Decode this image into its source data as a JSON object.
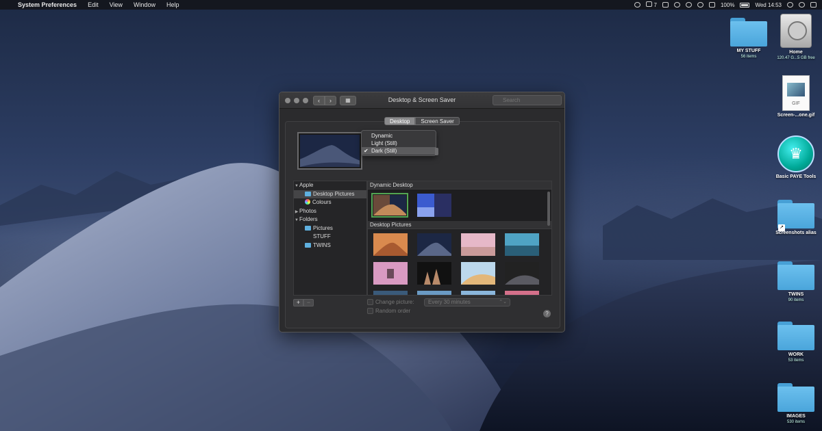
{
  "menubar": {
    "app_name": "System Preferences",
    "menus": [
      "Edit",
      "View",
      "Window",
      "Help"
    ],
    "status": {
      "notif_count": "7",
      "battery": "100%",
      "clock": "Wed 14:53"
    }
  },
  "window": {
    "title": "Desktop & Screen Saver",
    "search_placeholder": "Search",
    "tabs": [
      "Desktop",
      "Screen Saver"
    ],
    "active_tab": "Desktop",
    "appearance_menu": {
      "options": [
        "Dynamic",
        "Light (Still)",
        "Dark (Still)"
      ],
      "selected": "Dark (Still)",
      "check": "✔"
    },
    "sidebar": [
      {
        "label": "Apple",
        "type": "group",
        "expanded": true
      },
      {
        "label": "Desktop Pictures",
        "type": "folder",
        "selected": true
      },
      {
        "label": "Colours",
        "type": "colours"
      },
      {
        "label": "Photos",
        "type": "group",
        "expanded": false
      },
      {
        "label": "Folders",
        "type": "group",
        "expanded": true
      },
      {
        "label": "Pictures",
        "type": "folder"
      },
      {
        "label": "STUFF",
        "type": "plain"
      },
      {
        "label": "TWINS",
        "type": "folder"
      }
    ],
    "sections": {
      "dynamic": "Dynamic Desktop",
      "pictures": "Desktop Pictures"
    },
    "add_label": "+",
    "remove_label": "−",
    "change_picture_label": "Change picture:",
    "interval": "Every 30 minutes",
    "random_order_label": "Random order",
    "help_label": "?"
  },
  "desktop_icons": [
    {
      "name": "MY STUFF",
      "sub": "56 items",
      "kind": "folder"
    },
    {
      "name": "Home",
      "sub": "120.47 G...5 GB free",
      "kind": "hdd"
    },
    {
      "name": "Screen-...one.gif",
      "sub": "",
      "kind": "gif",
      "badge": "GIF"
    },
    {
      "name": "Basic PAYE Tools",
      "sub": "",
      "kind": "app",
      "glyph": "♛"
    },
    {
      "name": "Screenshots alias",
      "sub": "",
      "kind": "alias"
    },
    {
      "name": "TWINS",
      "sub": "90 items",
      "kind": "folder"
    },
    {
      "name": "WORK",
      "sub": "53 items",
      "kind": "folder"
    },
    {
      "name": "IMAGES",
      "sub": "530 items",
      "kind": "folder"
    }
  ],
  "colors": {
    "folder_blue": "#5fb0df",
    "selected_thumb_outline": "#52a552"
  }
}
